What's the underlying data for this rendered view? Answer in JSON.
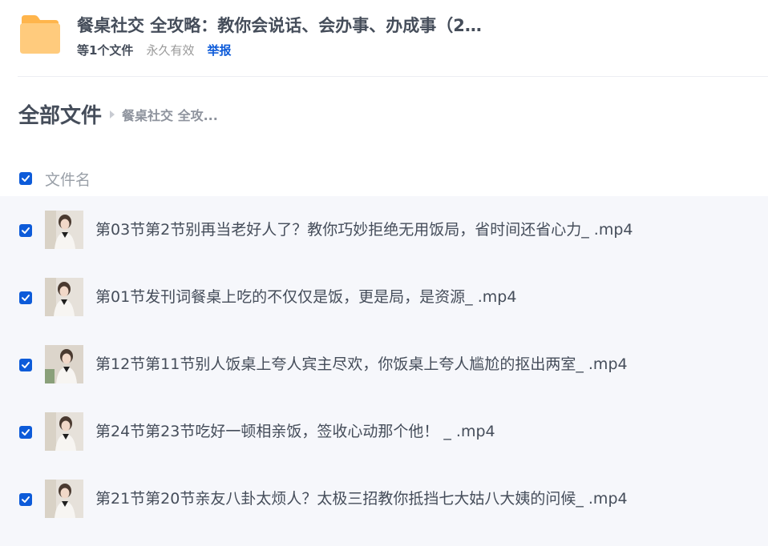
{
  "share": {
    "title": "餐桌社交 全攻略：教你会说话、会办事、办成事（2…",
    "file_count": "等1个文件",
    "validity": "永久有效",
    "report_label": "举报"
  },
  "breadcrumb": {
    "root": "全部文件",
    "current": "餐桌社交 全攻..."
  },
  "list": {
    "column_name": "文件名",
    "files": [
      {
        "name": "第03节第2节别再当老好人了？教你巧妙拒绝无用饭局，省时间还省心力_ .mp4"
      },
      {
        "name": "第01节发刊词餐桌上吃的不仅仅是饭，更是局，是资源_ .mp4"
      },
      {
        "name": "第12节第11节别人饭桌上夸人宾主尽欢，你饭桌上夸人尴尬的抠出两室_ .mp4"
      },
      {
        "name": "第24节第23节吃好一顿相亲饭，签收心动那个他！ _ .mp4"
      },
      {
        "name": "第21节第20节亲友八卦太烦人？太极三招教你抵挡七大姑八大姨的问候_ .mp4"
      }
    ]
  },
  "colors": {
    "accent": "#0d5bd9",
    "folder": "#ffc46b",
    "row_bg": "#f6f7fb"
  }
}
